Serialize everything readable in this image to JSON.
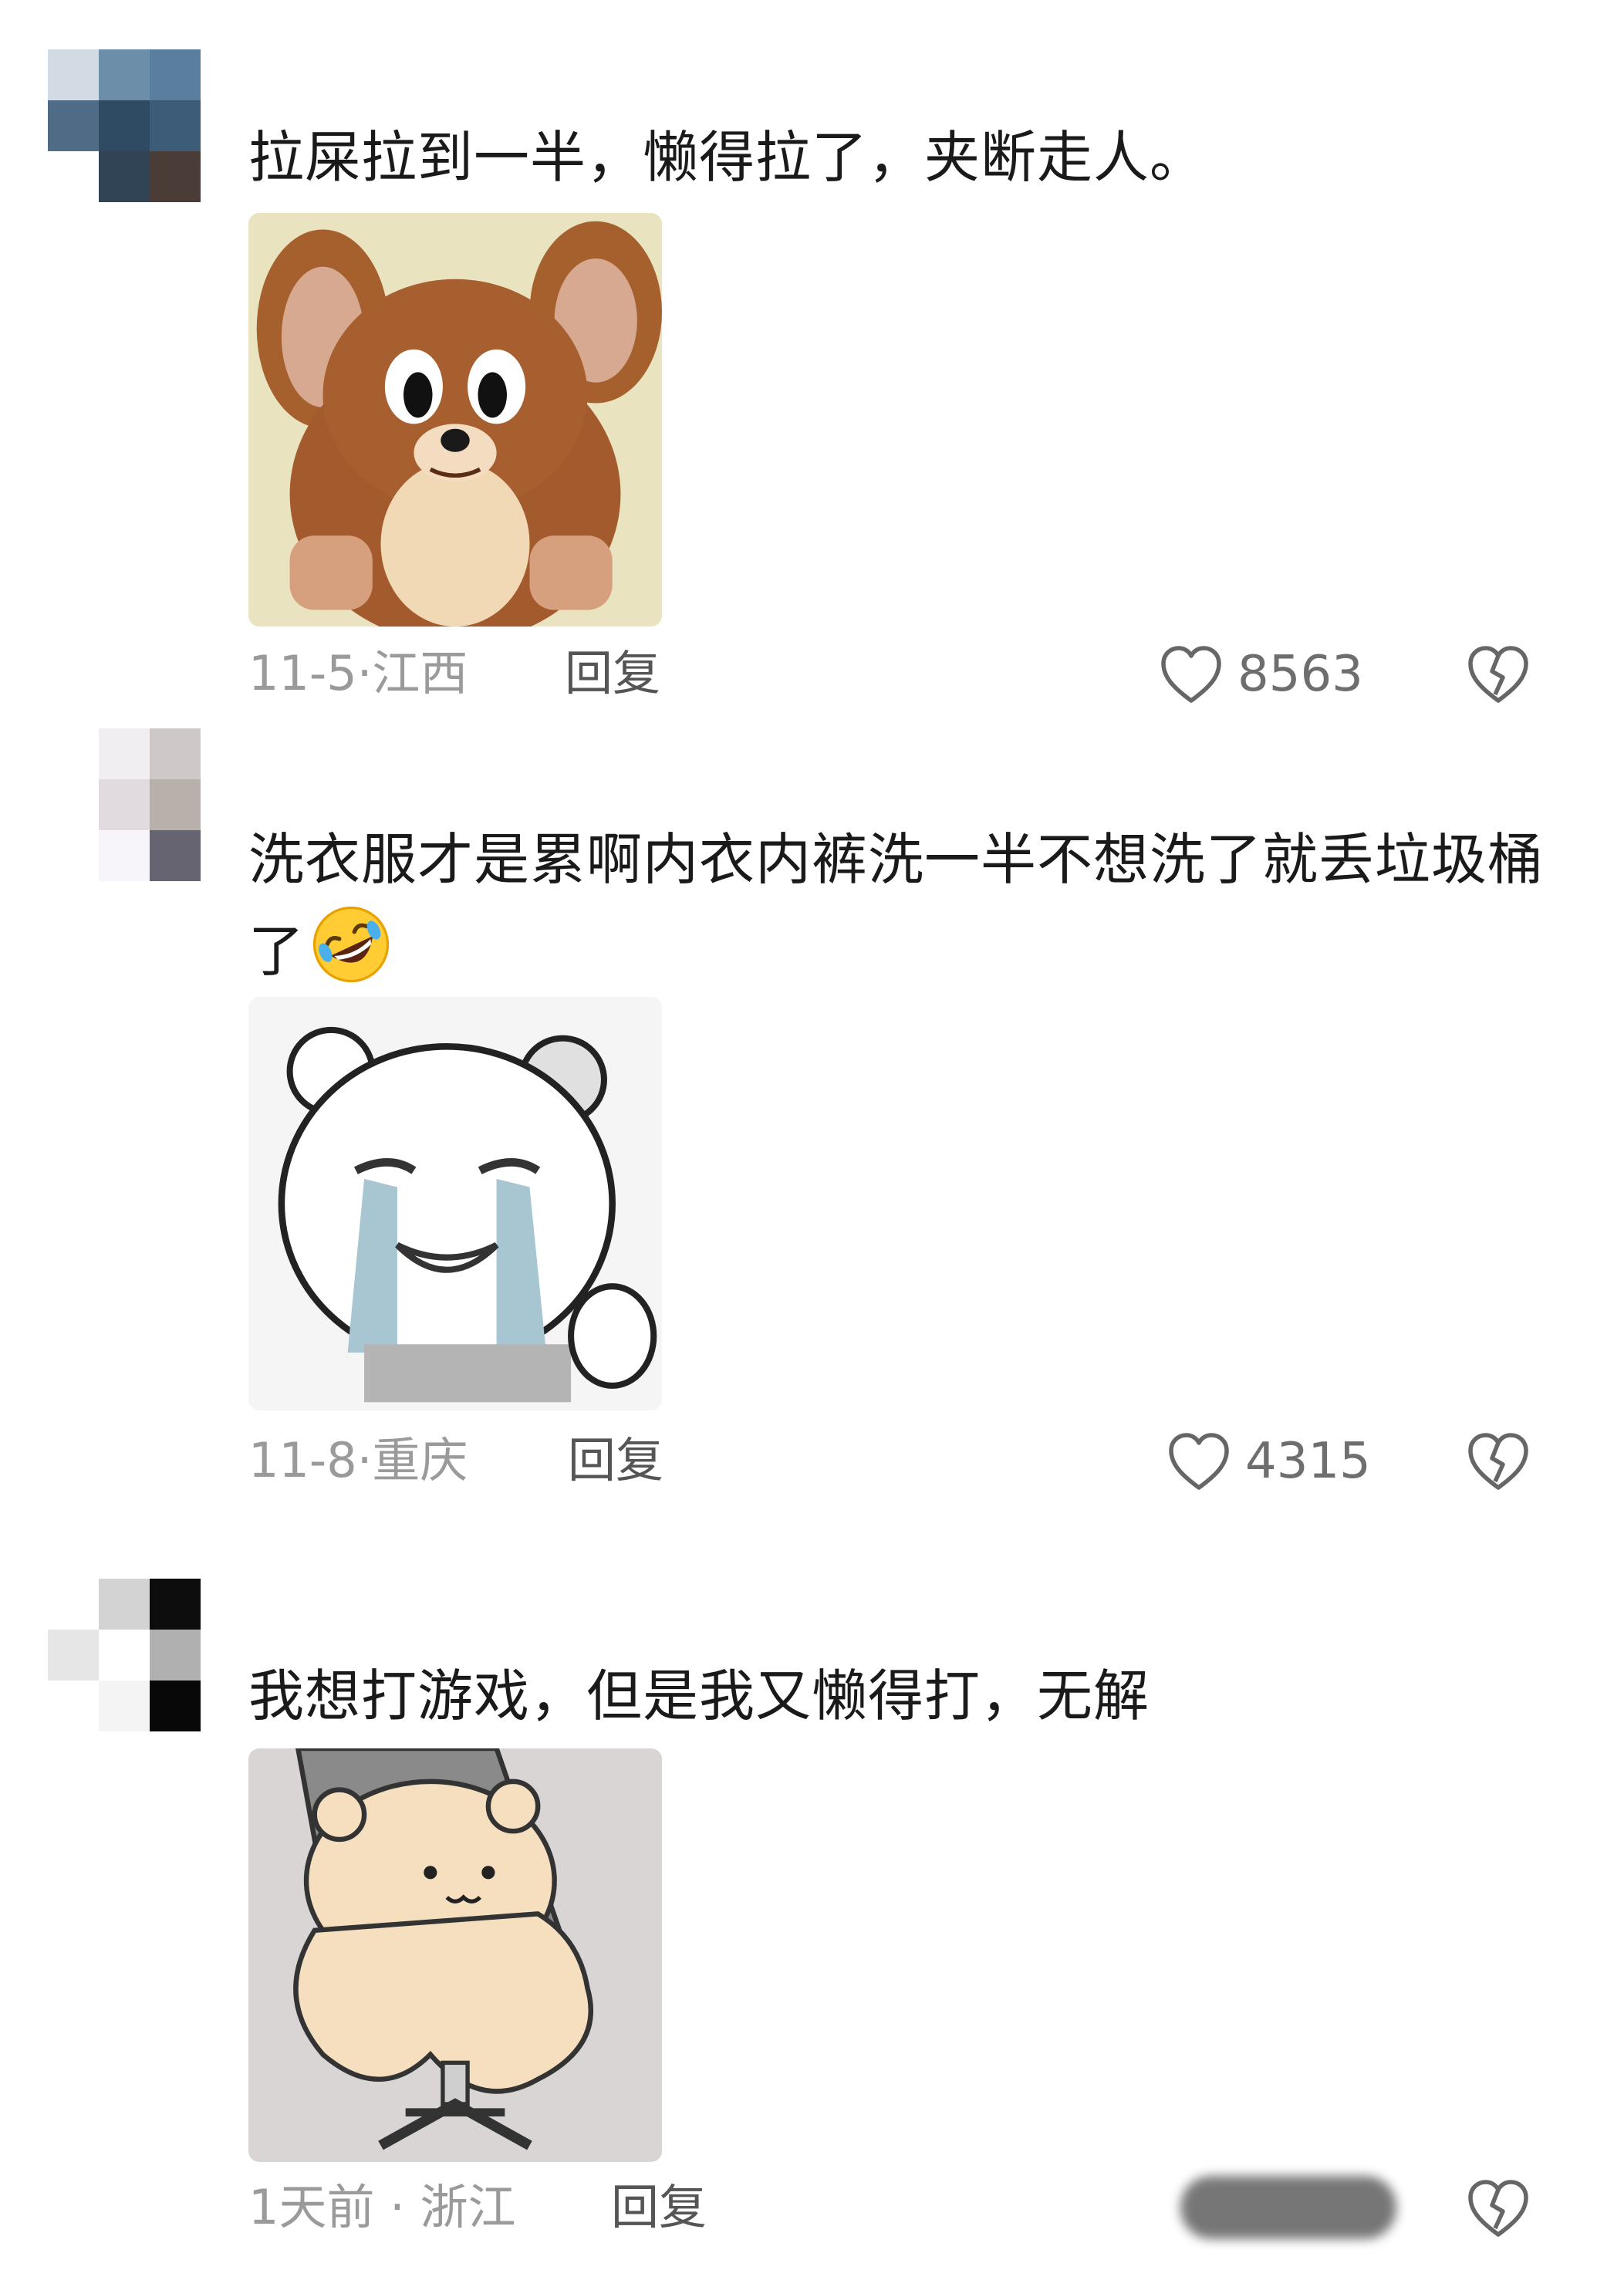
{
  "comments": [
    {
      "text": "拉屎拉到一半，懒得拉了，夹断走人。",
      "sticker": "tom-and-jerry-mouse-sticker",
      "date": "11-5",
      "location": "江西",
      "date_location": "11-5·江西",
      "reply_label": "回复",
      "likes": "8563"
    },
    {
      "text": "洗衣服才是累啊内衣内裤洗一半不想洗了就丢垃圾桶了",
      "emoji": "rolling-laughing-emoji",
      "sticker": "crying-white-bear-sticker",
      "date": "11-8",
      "location": "重庆",
      "date_location": "11-8·重庆",
      "reply_label": "回复",
      "likes": "4315"
    },
    {
      "text": "我想打游戏，但是我又懒得打，无解",
      "sticker": "lazy-bear-on-chair-sticker",
      "date": "1天前",
      "location": "浙江",
      "date_location": "1天前 · 浙江",
      "reply_label": "回复",
      "likes": ""
    }
  ],
  "icons": {
    "like": "heart-outline-icon",
    "dislike": "broken-heart-icon"
  },
  "colors": {
    "meta_text": "#9a9a9a",
    "reply_text": "#555555",
    "like_count": "#6e6e6e"
  }
}
